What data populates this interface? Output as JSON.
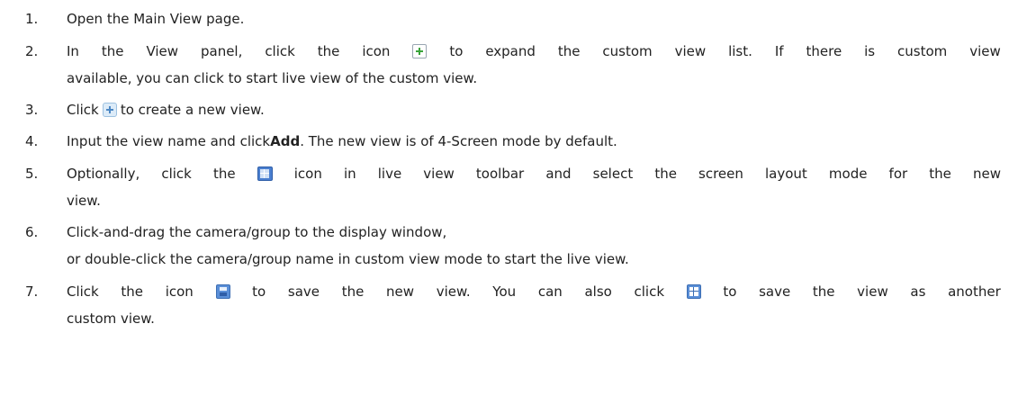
{
  "steps": [
    {
      "number": "1.",
      "lines": [
        [
          "Open the Main View page."
        ]
      ]
    },
    {
      "number": "2.",
      "lines": [
        [
          "In",
          "the",
          "View",
          "panel,",
          "click",
          "the",
          "icon",
          "{icon:expand-icon}",
          "to",
          "expand",
          "the",
          "custom",
          "view",
          "list.",
          "If",
          "there",
          "is",
          "custom",
          "view"
        ],
        [
          "available, you can click to start live view of the custom view."
        ]
      ]
    },
    {
      "number": "3.",
      "lines": [
        [
          "Click",
          "{icon:add-view-icon}",
          "to create a new view."
        ]
      ]
    },
    {
      "number": "4.",
      "lines": [
        [
          "Input the view name and click",
          "{bold:Add}",
          ". The new view is of 4-Screen mode by default."
        ]
      ]
    },
    {
      "number": "5.",
      "lines": [
        [
          "Optionally,",
          "click",
          "the",
          "{icon:screen-layout-icon}",
          "icon",
          "in",
          "live",
          "view",
          "toolbar",
          "and",
          "select",
          "the",
          "screen",
          "layout",
          "mode",
          "for",
          "the",
          "new"
        ],
        [
          "view."
        ]
      ]
    },
    {
      "number": "6.",
      "lines": [
        [
          "Click-and-drag the camera/group to the display window,"
        ],
        [
          "or double-click the camera/group name in custom view mode to start the live view."
        ]
      ]
    },
    {
      "number": "7.",
      "lines": [
        [
          "Click",
          "the",
          "icon",
          "{icon:save-view-icon}",
          "to",
          "save",
          "the",
          "new",
          "view.",
          "You",
          "can",
          "also",
          "click",
          "{icon:save-as-view-icon}",
          "to",
          "save",
          "the",
          "view",
          "as",
          "another"
        ],
        [
          "custom view."
        ]
      ]
    }
  ]
}
